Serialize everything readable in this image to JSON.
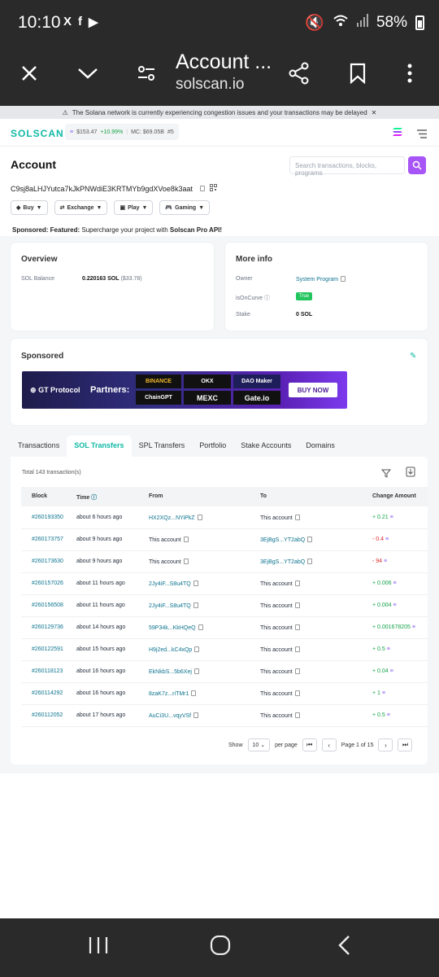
{
  "status": {
    "time": "10:10",
    "battery": "58%",
    "app_icons": [
      "X",
      "f",
      "▶"
    ]
  },
  "browser": {
    "page_title": "Account ...",
    "domain": "solscan.io"
  },
  "banner": {
    "text": "The Solana network is currently experiencing congestion issues and your transactions may be delayed"
  },
  "header": {
    "logo": "SOLSCAN",
    "price": "$153.47",
    "change": "+10.99%",
    "mcap": "MC: $69.05B",
    "rank": "#5"
  },
  "account": {
    "title": "Account",
    "address": "C9sj8aLHJYutca7kJkPNWdiE3KRTMYb9gdXVoe8k3aat",
    "search_placeholder": "Search transactions, blocks, programs",
    "actions": [
      "Buy",
      "Exchange",
      "Play",
      "Gaming"
    ],
    "sponsored_prefix": "Sponsored: Featured:",
    "sponsored_text": "Supercharge your project with",
    "sponsored_link": "Solscan Pro API!"
  },
  "overview": {
    "title": "Overview",
    "balance_label": "SOL Balance",
    "balance_value": "0.220163 SOL",
    "balance_usd": "($33.78)"
  },
  "more_info": {
    "title": "More info",
    "owner_label": "Owner",
    "owner_value": "System Program",
    "curve_label": "isOnCurve",
    "curve_value": "True",
    "stake_label": "Stake",
    "stake_value": "0 SOL"
  },
  "sponsored": {
    "title": "Sponsored",
    "ad_brand": "GT Protocol",
    "ad_partners": "Partners:",
    "ad_cta": "BUY NOW",
    "ad_logos": [
      "BINANCE",
      "OKX",
      "DAO Maker",
      "ChainGPT",
      "MEXC",
      "Gate.io"
    ]
  },
  "tabs": [
    "Transactions",
    "SOL Transfers",
    "SPL Transfers",
    "Portfolio",
    "Stake Accounts",
    "Domains"
  ],
  "table": {
    "total": "Total 143 transaction(s)",
    "headers": [
      "Block",
      "Time",
      "From",
      "To",
      "Change Amount"
    ],
    "rows": [
      {
        "block": "#260193350",
        "time": "about 6 hours ago",
        "from": "HX2XQz...NYiPkZ",
        "to": "This account",
        "amount": "+ 0.21",
        "dir": "in"
      },
      {
        "block": "#260173757",
        "time": "about 9 hours ago",
        "from": "This account",
        "to": "3EjBgS...YT2abQ",
        "amount": "- 0.4",
        "dir": "out"
      },
      {
        "block": "#260173630",
        "time": "about 9 hours ago",
        "from": "This account",
        "to": "3EjBgS...YT2abQ",
        "amount": "- 94",
        "dir": "out"
      },
      {
        "block": "#260157026",
        "time": "about 11 hours ago",
        "from": "2Jy4iF...S8u4TQ",
        "to": "This account",
        "amount": "+ 0.006",
        "dir": "in"
      },
      {
        "block": "#260156508",
        "time": "about 11 hours ago",
        "from": "2Jy4iF...S8u4TQ",
        "to": "This account",
        "amount": "+ 0.004",
        "dir": "in"
      },
      {
        "block": "#260129736",
        "time": "about 14 hours ago",
        "from": "59P34k...KkHQeQ",
        "to": "This account",
        "amount": "+ 0.001678205",
        "dir": "in"
      },
      {
        "block": "#260122591",
        "time": "about 15 hours ago",
        "from": "H9j2ed...kC4xQp",
        "to": "This account",
        "amount": "+ 0.5",
        "dir": "in"
      },
      {
        "block": "#260118123",
        "time": "about 16 hours ago",
        "from": "EkNkbS...5b6Xej",
        "to": "This account",
        "amount": "+ 0.04",
        "dir": "in"
      },
      {
        "block": "#260114292",
        "time": "about 16 hours ago",
        "from": "8zaK7z...riTMr1",
        "to": "This account",
        "amount": "+ 1",
        "dir": "in"
      },
      {
        "block": "#260112052",
        "time": "about 17 hours ago",
        "from": "AuCi3U...vqyVSf",
        "to": "This account",
        "amount": "+ 0.5",
        "dir": "in"
      }
    ]
  },
  "pager": {
    "show_label": "Show",
    "per_page_value": "10",
    "per_page_label": "per page",
    "page_text": "Page 1 of 15"
  },
  "colors": {
    "accent": "#10b9a5",
    "link": "#0e7490",
    "positive": "#16a34a",
    "negative": "#dc2626",
    "search": "#a855f7"
  }
}
